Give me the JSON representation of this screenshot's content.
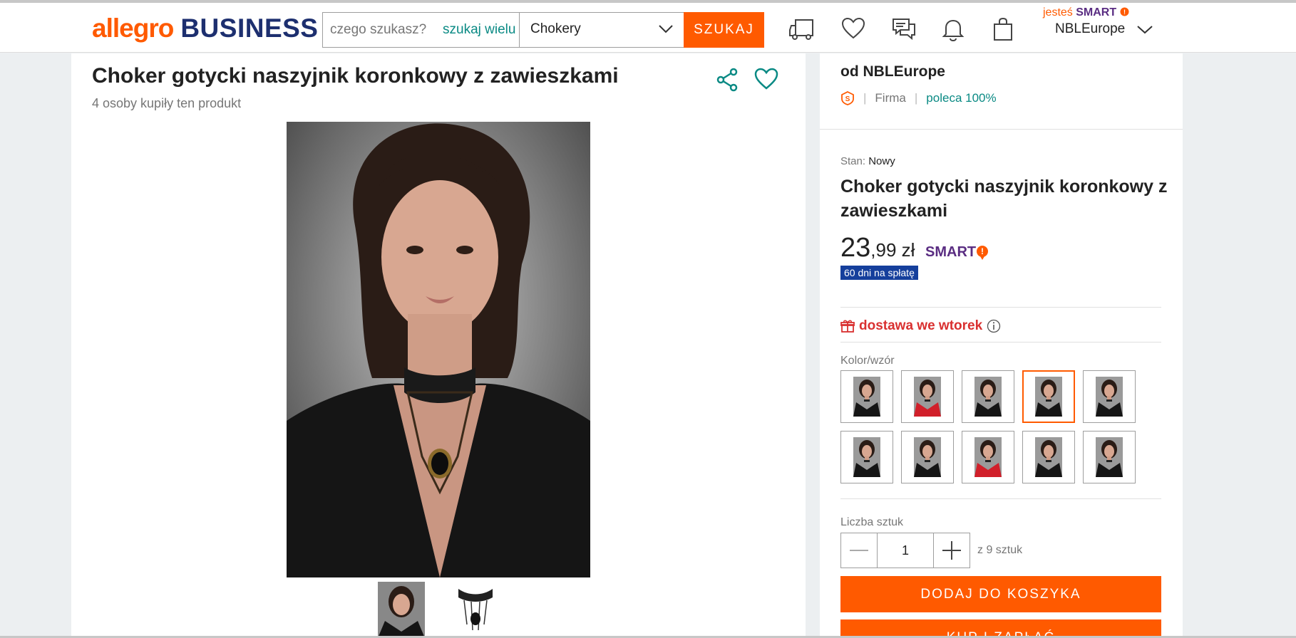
{
  "header": {
    "logo_allegro": "allegro",
    "logo_business": "BUSINESS",
    "search_placeholder": "czego szukasz?",
    "search_many": "szukaj wielu",
    "category": "Chokery",
    "search_button": "SZUKAJ",
    "smart_prefix": "jesteś",
    "smart_label": "SMART",
    "username": "NBLEurope"
  },
  "product": {
    "title": "Choker gotycki naszyjnik koronkowy z zawieszkami",
    "bought": "4 osoby kupiły ten produkt"
  },
  "sidebar": {
    "seller": "od NBLEurope",
    "seller_type": "Firma",
    "recommend": "poleca 100%",
    "condition_label": "Stan:",
    "condition_value": "Nowy",
    "title": "Choker gotycki naszyjnik koronkowy z zawieszkami",
    "price_main": "23",
    "price_decimals": ",99 zł",
    "smart_badge": "SMART",
    "payment_badge": "60 dni na spłatę",
    "delivery": "dostawa we wtorek",
    "variant_label": "Kolor/wzór",
    "qty_label": "Liczba sztuk",
    "qty_value": "1",
    "qty_of": "z 9 sztuk",
    "add_to_cart": "DODAJ DO KOSZYKA",
    "buy_now": "KUP I ZAPŁAĆ"
  },
  "variants": [
    {
      "outfit": "black",
      "selected": false
    },
    {
      "outfit": "red",
      "selected": false
    },
    {
      "outfit": "black",
      "selected": false
    },
    {
      "outfit": "black",
      "selected": true
    },
    {
      "outfit": "black",
      "selected": false
    },
    {
      "outfit": "black",
      "selected": false
    },
    {
      "outfit": "black",
      "selected": false
    },
    {
      "outfit": "red",
      "selected": false
    },
    {
      "outfit": "black",
      "selected": false
    },
    {
      "outfit": "black",
      "selected": false
    }
  ],
  "colors": {
    "accent": "#ff5a00",
    "teal": "#0a8a84",
    "navy": "#1d2f6f",
    "smart_purple": "#5a2d82",
    "delivery_red": "#d93030",
    "pay_blue": "#153f9c"
  },
  "icons": [
    "delivery-truck-icon",
    "heart-icon",
    "chat-icon",
    "bell-icon",
    "shopping-bag-icon",
    "chevron-down-icon",
    "share-icon",
    "info-icon",
    "gift-icon",
    "minus-icon",
    "plus-icon",
    "super-seller-icon"
  ]
}
